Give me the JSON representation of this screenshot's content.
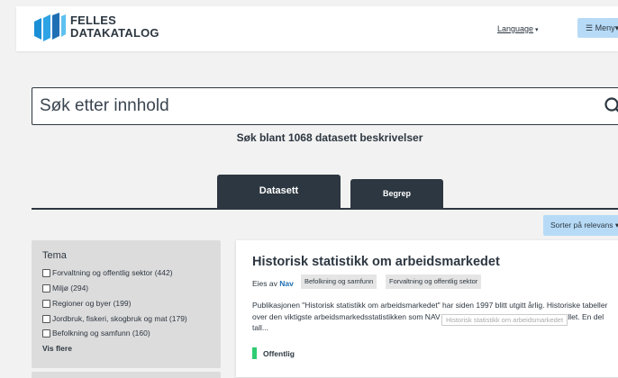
{
  "header": {
    "logo_line1": "FELLES",
    "logo_line2": "DATAKATALOG",
    "language_label": "Language",
    "menu_label": "Meny"
  },
  "search": {
    "placeholder": "Søk etter innhold",
    "count_text": "Søk blant 1068 datasett beskrivelser"
  },
  "tabs": [
    {
      "label": "Datasett",
      "active": true
    },
    {
      "label": "Begrep",
      "active": false
    }
  ],
  "sort_label": "Sorter på relevans",
  "sidebar": {
    "title": "Tema",
    "items": [
      {
        "label": "Forvaltning og offentlig sektor (442)",
        "checked": false
      },
      {
        "label": "Miljø (294)",
        "checked": false
      },
      {
        "label": "Regioner og byer (199)",
        "checked": false
      },
      {
        "label": "Jordbruk, fiskeri, skogbruk og mat (179)",
        "checked": false
      },
      {
        "label": "Befolkning og samfunn (160)",
        "checked": false
      }
    ],
    "show_more": "Vis flere"
  },
  "result": {
    "title": "Historisk statistikk om arbeidsmarkedet",
    "owner_prefix": "Eies av",
    "owner": "Nav",
    "tags": [
      "Befolkning og samfunn",
      "Forvaltning og offentlig sektor"
    ],
    "description": "Publikasjonen \"Historisk statistikk om arbeidsmarkedet\" har siden 1997 blitt utgitt årlig. Historiske tabeller over den viktigste arbeidsmarkedsstatistikken som NAV har publisert siden slutten av 1940-tallet. En del tall...",
    "tooltip": "Historisk statistikk om arbeidsmarkedet",
    "access": "Offentlig"
  },
  "colors": {
    "primary": "#2d3741",
    "accent_button": "#b7dbf7",
    "link": "#1f6fb5",
    "access_green": "#2ecc71",
    "sidebar_bg": "#dcdcdc"
  }
}
